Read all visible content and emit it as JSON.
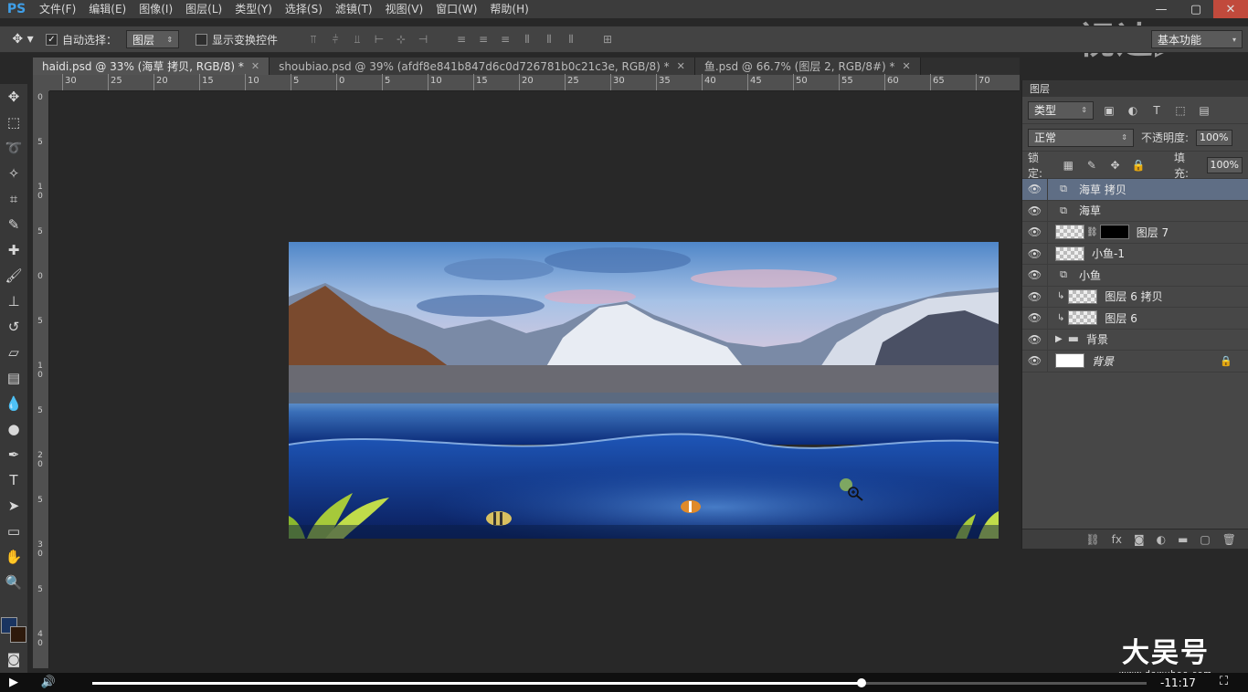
{
  "app": {
    "logo": "PS"
  },
  "menu": [
    "文件(F)",
    "编辑(E)",
    "图像(I)",
    "图层(L)",
    "类型(Y)",
    "选择(S)",
    "滤镜(T)",
    "视图(V)",
    "窗口(W)",
    "帮助(H)"
  ],
  "window_controls": {
    "minimize": "—",
    "maximize": "▢",
    "close": "✕"
  },
  "options": {
    "auto_select_label": "自动选择：",
    "auto_select_checked": true,
    "auto_select_target": "图层",
    "show_transform_label": "显示变换控件",
    "workspace": "基本功能"
  },
  "tabs": [
    {
      "title": "haidi.psd @ 33% (海草 拷贝, RGB/8) *",
      "active": true
    },
    {
      "title": "shoubiao.psd @ 39% (afdf8e841b847d6c0d726781b0c21c3e, RGB/8) *",
      "active": false
    },
    {
      "title": "鱼.psd @ 66.7% (图层 2, RGB/8#) *",
      "active": false
    }
  ],
  "ruler_top_labels": [
    "30",
    "25",
    "20",
    "15",
    "10",
    "5",
    "0",
    "5",
    "10",
    "15",
    "20",
    "25",
    "30",
    "35",
    "40",
    "45",
    "50",
    "55",
    "60",
    "65",
    "70"
  ],
  "ruler_left_labels": [
    "0",
    "5",
    "1 0",
    "5",
    "0",
    "5",
    "1 0",
    "5",
    "2 0",
    "5",
    "3 0",
    "5",
    "4 0"
  ],
  "layers_panel": {
    "title": "图层",
    "kind_filter": "类型",
    "blend_mode": "正常",
    "opacity_label": "不透明度:",
    "opacity": "100%",
    "lock_label": "锁定:",
    "fill_label": "填充:",
    "fill": "100%",
    "layers": [
      {
        "name": "海草 拷贝",
        "type": "smart",
        "selected": true
      },
      {
        "name": "海草",
        "type": "smart",
        "selected": false
      },
      {
        "name": "图层 7",
        "type": "masked",
        "selected": false
      },
      {
        "name": "小鱼-1",
        "type": "pixel",
        "selected": false
      },
      {
        "name": "小鱼",
        "type": "smart",
        "selected": false
      },
      {
        "name": "图层 6 拷贝",
        "type": "clipped",
        "selected": false
      },
      {
        "name": "图层 6",
        "type": "clipped",
        "selected": false
      },
      {
        "name": "背景",
        "type": "group",
        "selected": false
      },
      {
        "name": "背景",
        "type": "background",
        "selected": false
      }
    ]
  },
  "watermark": {
    "top": "视达",
    "bottom_big": "大吴号",
    "bottom_small": "www.dawuhao.com"
  },
  "video": {
    "time": "-11:17",
    "progress": 0.73
  }
}
